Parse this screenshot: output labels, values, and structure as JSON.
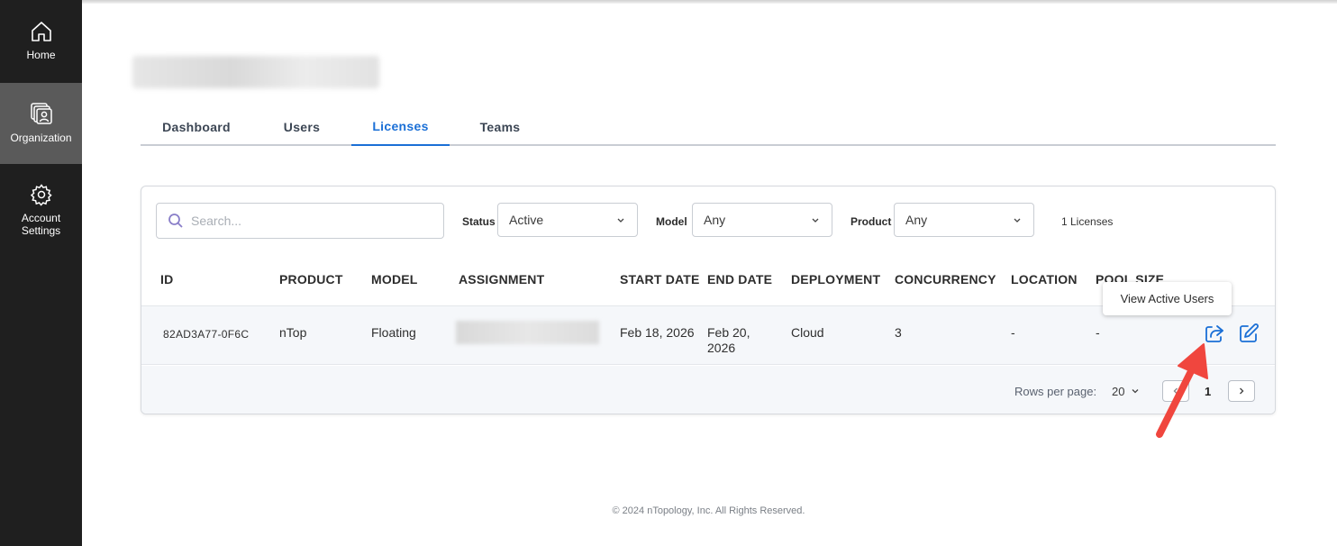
{
  "sidebar": {
    "items": [
      {
        "label": "Home",
        "icon": "home-icon"
      },
      {
        "label": "Organization",
        "icon": "organization-icon",
        "active": true
      },
      {
        "label_line1": "Account",
        "label_line2": "Settings",
        "icon": "gear-icon"
      }
    ]
  },
  "tabs": [
    {
      "label": "Dashboard"
    },
    {
      "label": "Users"
    },
    {
      "label": "Licenses",
      "active": true
    },
    {
      "label": "Teams"
    }
  ],
  "filters": {
    "search_placeholder": "Search...",
    "status_label": "Status",
    "status_value": "Active",
    "model_label": "Model",
    "model_value": "Any",
    "product_label": "Product",
    "product_value": "Any",
    "count_text": "1 Licenses"
  },
  "table": {
    "headers": [
      "ID",
      "PRODUCT",
      "MODEL",
      "ASSIGNMENT",
      "START DATE",
      "END DATE",
      "DEPLOYMENT",
      "CONCURRENCY",
      "LOCATION",
      "POOL SIZE"
    ],
    "rows": [
      {
        "id": "82AD3A77-0F6C",
        "product": "nTop",
        "model": "Floating",
        "start_date": "Feb 18, 2026",
        "end_date_line1": "Feb 20,",
        "end_date_line2": "2026",
        "deployment": "Cloud",
        "concurrency": "3",
        "location": "-",
        "pool_size": "-"
      }
    ]
  },
  "pagination": {
    "rows_per_page_label": "Rows per page:",
    "rows_per_page_value": "20",
    "current_page": "1"
  },
  "tooltip": {
    "text": "View Active Users"
  },
  "footer": {
    "copyright": "© 2024 nTopology, Inc. All Rights Reserved."
  },
  "colors": {
    "accent": "#1a6fd6",
    "sidebar_bg": "#1f1f1f",
    "sidebar_active": "#5a5a5a",
    "annotation_arrow": "#f0463e"
  }
}
